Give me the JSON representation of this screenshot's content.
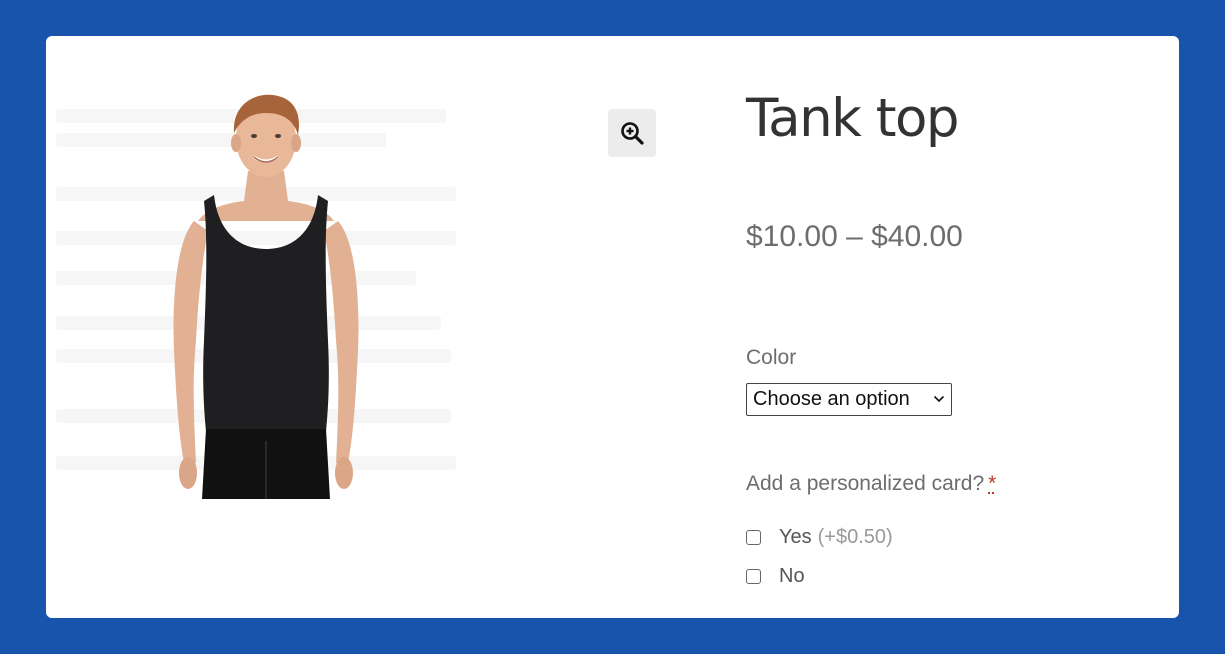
{
  "product": {
    "title": "Tank top",
    "price_range": "$10.00 – $40.00",
    "image_alt": "Man wearing a black tank top"
  },
  "gallery": {
    "zoom_icon": "zoom-in-icon"
  },
  "color": {
    "label": "Color",
    "selected": "Choose an option"
  },
  "personalized_card": {
    "label": "Add a personalized card?",
    "required_mark": "*",
    "options": [
      {
        "label": "Yes",
        "extra": "(+$0.50)",
        "checked": false
      },
      {
        "label": "No",
        "extra": "",
        "checked": false
      }
    ]
  },
  "colors": {
    "page_background": "#1854ab",
    "card_background": "#ffffff",
    "title_text": "#333333",
    "body_text": "#6d6d6d",
    "required": "#c0392b"
  }
}
